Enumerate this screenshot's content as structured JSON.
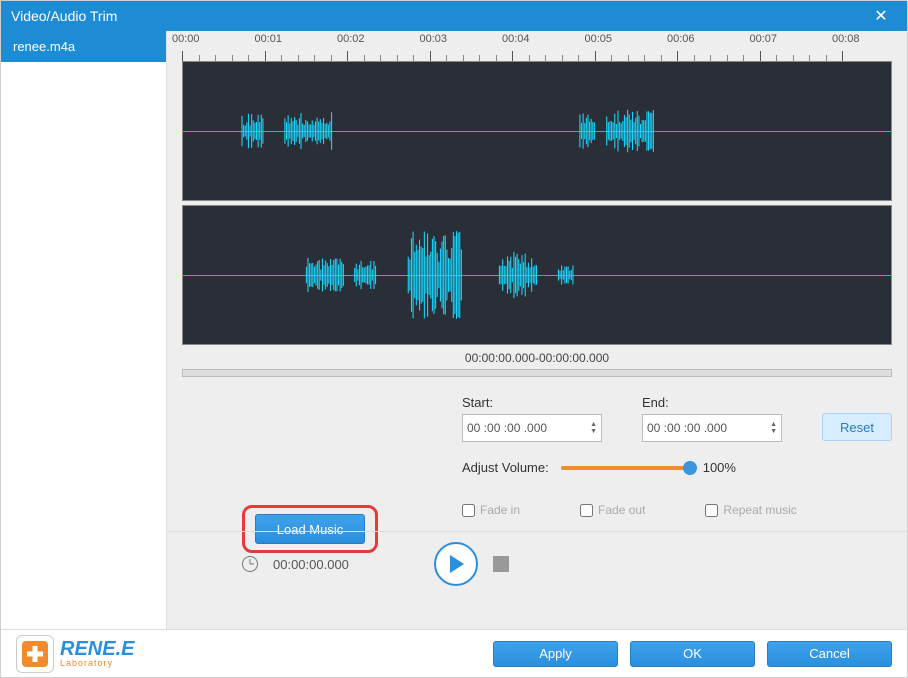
{
  "window": {
    "title": "Video/Audio Trim"
  },
  "sidebar": {
    "items": [
      {
        "label": "renee.m4a"
      }
    ]
  },
  "ruler": {
    "ticks": [
      "00:00",
      "00:01",
      "00:02",
      "00:03",
      "00:04",
      "00:05",
      "00:06",
      "00:07",
      "00:08"
    ]
  },
  "time_range_label": "00:00:00.000-00:00:00.000",
  "start": {
    "label": "Start:",
    "value": "00 :00 :00 .000"
  },
  "end": {
    "label": "End:",
    "value": "00 :00 :00 .000"
  },
  "reset_label": "Reset",
  "volume": {
    "label": "Adjust Volume:",
    "value_label": "100%",
    "percent": 100
  },
  "load_music_label": "Load Music",
  "checks": {
    "fade_in": "Fade in",
    "fade_out": "Fade out",
    "repeat": "Repeat music"
  },
  "playbar": {
    "time": "00:00:00.000"
  },
  "footer": {
    "brand": "RENE.E",
    "brand_sub": "Laboratory",
    "apply": "Apply",
    "ok": "OK",
    "cancel": "Cancel"
  }
}
